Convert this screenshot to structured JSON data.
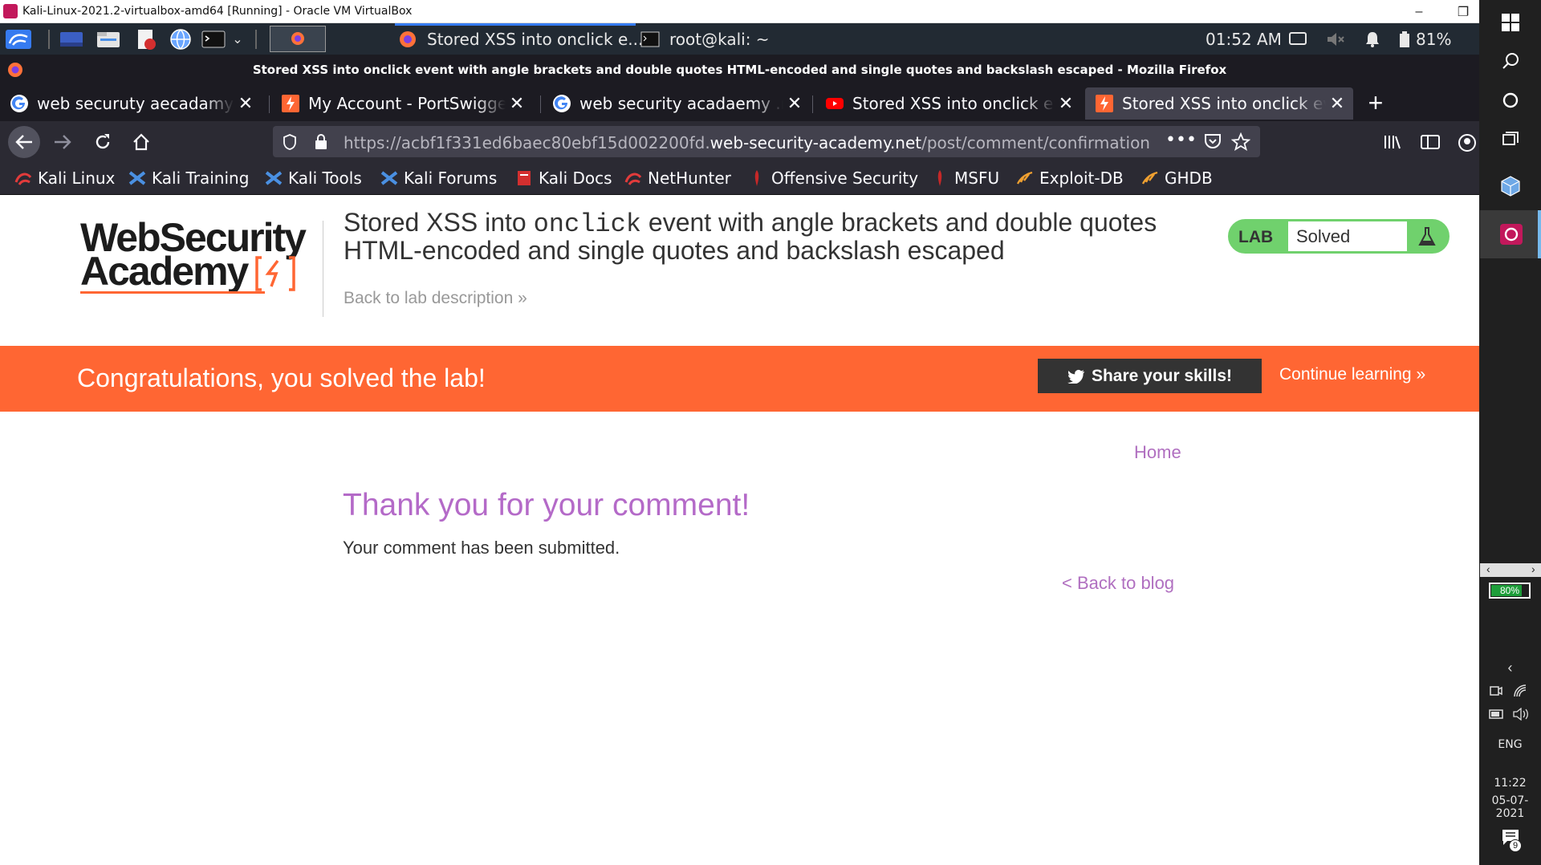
{
  "vbox": {
    "title": "Kali-Linux-2021.2-virtualbox-amd64 [Running] - Oracle VM VirtualBox",
    "minimize": "–",
    "restore": "❐"
  },
  "kali_panel": {
    "task_firefox": "Stored XSS into onclick e...",
    "task_terminal": "root@kali: ~",
    "time": "01:52 AM",
    "battery": "81%"
  },
  "firefox": {
    "window_title": "Stored XSS into onclick event with angle brackets and double quotes HTML-encoded and single quotes and backslash escaped - Mozilla Firefox",
    "tabs": [
      {
        "label": "web securuty aecadamy - Google"
      },
      {
        "label": "My Account - PortSwigger"
      },
      {
        "label": "web security acadaemy .net - Google"
      },
      {
        "label": "Stored XSS into onclick event"
      },
      {
        "label": "Stored XSS into onclick event"
      }
    ],
    "url_prefix": "https://acbf1f331ed6baec80ebf15d002200fd.",
    "url_domain": "web-security-academy.net",
    "url_path": "/post/comment/confirmation",
    "bookmarks": [
      "Kali Linux",
      "Kali Training",
      "Kali Tools",
      "Kali Forums",
      "Kali Docs",
      "NetHunter",
      "Offensive Security",
      "MSFU",
      "Exploit-DB",
      "GHDB"
    ]
  },
  "page": {
    "logo_line1": "WebSecurity",
    "logo_line2": "Academy",
    "lab_title_a": "Stored XSS into ",
    "lab_title_code": "onclick",
    "lab_title_b": " event with angle brackets and double quotes HTML-encoded and single quotes and backslash escaped",
    "back_to_description": "Back to lab description »",
    "badge_lab": "LAB",
    "badge_status": "Solved",
    "congrats": "Congratulations, you solved the lab!",
    "share": "Share your skills!",
    "continue": "Continue learning »",
    "home": "Home",
    "thanks": "Thank you for your comment!",
    "submitted": "Your comment has been submitted.",
    "back_to_blog": "< Back to blog"
  },
  "windows_taskbar": {
    "vbox_battery": "80%",
    "language": "ENG",
    "time": "11:22",
    "date": "05-07-2021",
    "notifications": "9"
  },
  "colors": {
    "orange": "#ff6633",
    "purple_link": "#b06fc0",
    "solved_green": "#70d16d"
  }
}
